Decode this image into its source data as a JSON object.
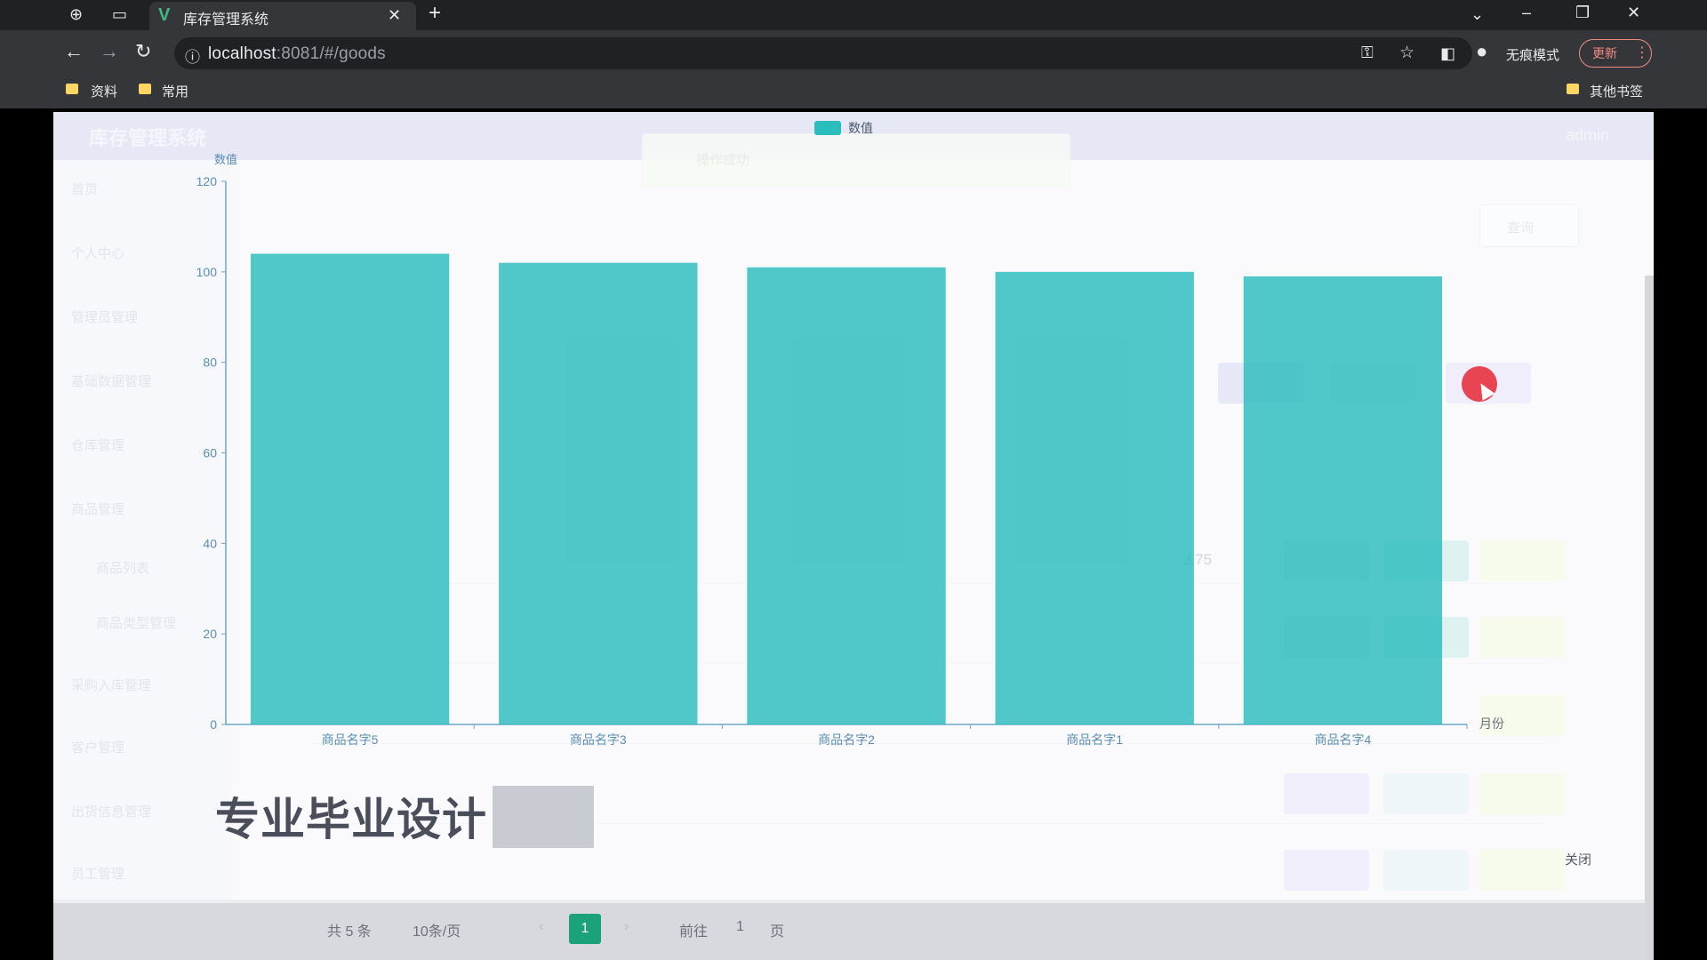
{
  "browser": {
    "tab_title": "库存管理系统",
    "url_host": "localhost",
    "url_rest": ":8081/#/goods",
    "incognito_label": "无痕模式",
    "update_label": "更新",
    "bookmarks": [
      "资料",
      "常用"
    ],
    "other_bookmarks": "其他书签"
  },
  "app": {
    "title": "库存管理系统",
    "header_user": "admin",
    "sidebar": [
      "首页",
      "个人中心",
      "管理员管理",
      "基础数据管理",
      "仓库管理",
      "商品管理",
      "商品列表",
      "商品类型管理",
      "采购入库管理",
      "客户管理",
      "出货信息管理",
      "员工管理"
    ],
    "toast": "操作成功",
    "search_button": "查询",
    "ghost_value": "3.75",
    "footer": {
      "total": "共 5 条",
      "page_size": "10条/页",
      "current_page": "1",
      "goto_label": "前往",
      "goto_value": "1",
      "page_unit": "页"
    },
    "watermark": "专业毕业设计",
    "close_label": "关闭",
    "month_label": "月份"
  },
  "chart_data": {
    "type": "bar",
    "legend": [
      "数值"
    ],
    "ylabel": "数值",
    "ylim": [
      0,
      120
    ],
    "yticks": [
      0,
      20,
      40,
      60,
      80,
      100,
      120
    ],
    "categories": [
      "商品名字5",
      "商品名字3",
      "商品名字2",
      "商品名字1",
      "商品名字4"
    ],
    "series": [
      {
        "name": "数值",
        "values": [
          104,
          102,
          101,
          100,
          99
        ]
      }
    ],
    "legend_position": "top-center",
    "bar_color": "#2bbcbc",
    "grid": false
  }
}
